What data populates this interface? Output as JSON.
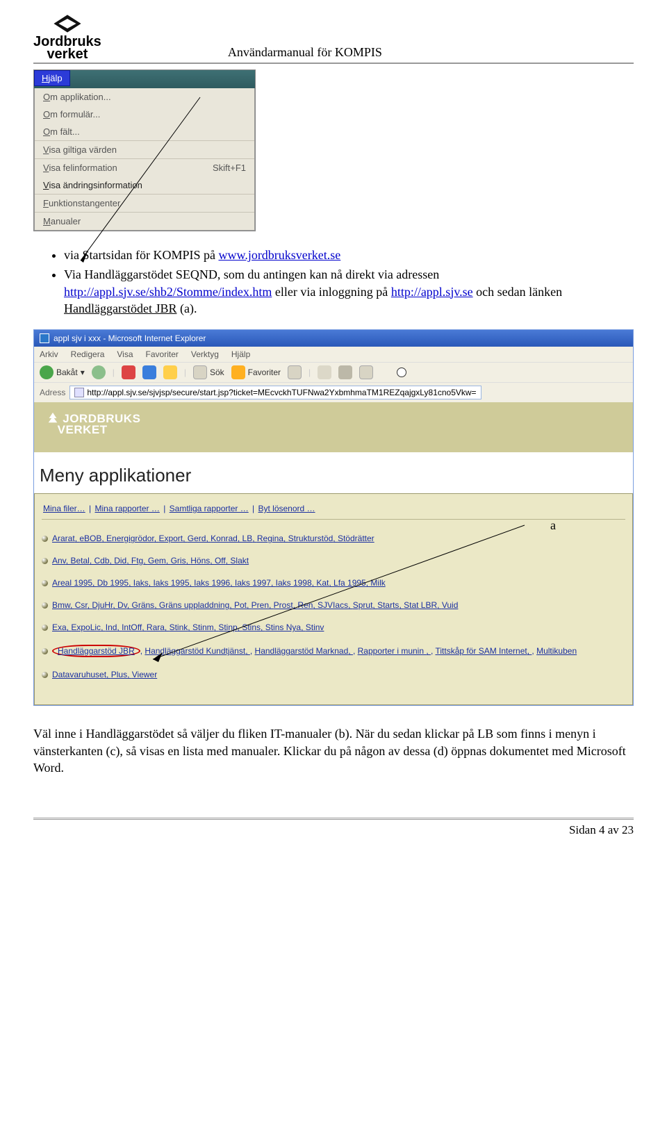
{
  "header": {
    "logo_line1": "Jordbruks",
    "logo_line2": "verket",
    "title": "Användarmanual för KOMPIS"
  },
  "win_menu": {
    "button": "Hjälp",
    "items": [
      {
        "label": "Om applikation...",
        "shortcut": ""
      },
      {
        "label": "Om formulär...",
        "shortcut": ""
      },
      {
        "label": "Om fält...",
        "shortcut": ""
      },
      {
        "label": "Visa giltiga värden",
        "shortcut": "",
        "sep": true
      },
      {
        "label": "Visa felinformation",
        "shortcut": "Skift+F1",
        "sep": true
      },
      {
        "label": "Visa ändringsinformation",
        "shortcut": "",
        "strong": true
      },
      {
        "label": "Funktionstangenter",
        "shortcut": "",
        "sep": true
      },
      {
        "label": "Manualer",
        "shortcut": "",
        "sep": true
      }
    ]
  },
  "bullets": {
    "b1_prefix": "via Startsidan för KOMPIS på ",
    "b1_link": "www.jordbruksverket.se",
    "b2_p1": "Via Handläggarstödet SEQND, som du antingen kan nå direkt via adressen ",
    "b2_link1": "http://appl.sjv.se/shb2/Stomme/index.htm",
    "b2_p2": " eller via inloggning på ",
    "b2_link2": "http://appl.sjv.se",
    "b2_p3": " och sedan länken ",
    "b2_u": "Handläggarstödet JBR",
    "b2_p4": " (a)."
  },
  "ie": {
    "title": "appl sjv i xxx - Microsoft Internet Explorer",
    "menus": [
      "Arkiv",
      "Redigera",
      "Visa",
      "Favoriter",
      "Verktyg",
      "Hjälp"
    ],
    "back": "Bakåt",
    "search": "Sök",
    "fav": "Favoriter",
    "addr_label": "Adress",
    "addr_value": "http://appl.sjv.se/sjvjsp/secure/start.jsp?ticket=MEcvckhTUFNwa2YxbmhmaTM1REZqajgxLy81cno5Vkw="
  },
  "banner": {
    "line1": "JORDBRUKS",
    "line2": "VERKET"
  },
  "meny": {
    "title": "Meny applikationer",
    "top_links": [
      "Mina filer…",
      "Mina rapporter …",
      "Samtliga rapporter …",
      "Byt lösenord …"
    ],
    "rows": [
      [
        "Ararat",
        "eBOB",
        "Energigrödor",
        "Export",
        "Gerd",
        "Konrad",
        "LB",
        "Regina",
        "Strukturstöd",
        "Stödrätter"
      ],
      [
        "Anv",
        "Betal",
        "Cdb",
        "Did",
        "Ftg",
        "Gem",
        "Gris",
        "Höns",
        "Off",
        "Slakt"
      ],
      [
        "Areal 1995",
        "Db 1995",
        "Iaks",
        "Iaks 1995",
        "Iaks 1996",
        "Iaks 1997",
        "Iaks 1998",
        "Kat",
        "Lfa 1995",
        "Milk"
      ],
      [
        "Bmw",
        "Csr",
        "DjuHr",
        "Dv",
        "Gräns",
        "Gräns uppladdning",
        "Pot",
        "Pren",
        "Prost",
        "Ren",
        "SJVIacs",
        "Sprut",
        "Starts",
        "Stat LBR",
        "Vuid"
      ],
      [
        "Exa",
        "ExpoLic",
        "Ind",
        "IntOff",
        "Rara",
        "Stink",
        "Stinm",
        "Stinp",
        "Stins",
        "Stins Nya",
        "Stinv"
      ]
    ],
    "special_row_first": "Handläggarstöd JBR",
    "special_row_rest": [
      "Handläggarstöd Kundtjänst",
      "Handläggarstöd Marknad",
      "Rapporter i munin ",
      "Tittskåp för SAM Internet",
      "Multikuben"
    ],
    "last_row": [
      "Datavaruhuset",
      "Plus",
      "Viewer"
    ],
    "anno_a": "a"
  },
  "para": {
    "text": "Väl inne i Handläggarstödet så väljer du fliken IT-manualer (b). När du sedan klickar på LB som finns i menyn i vänsterkanten (c), så visas en lista med manualer. Klickar du på någon av dessa (d) öppnas dokumentet med Microsoft Word."
  },
  "footer": {
    "text": "Sidan 4 av 23"
  }
}
